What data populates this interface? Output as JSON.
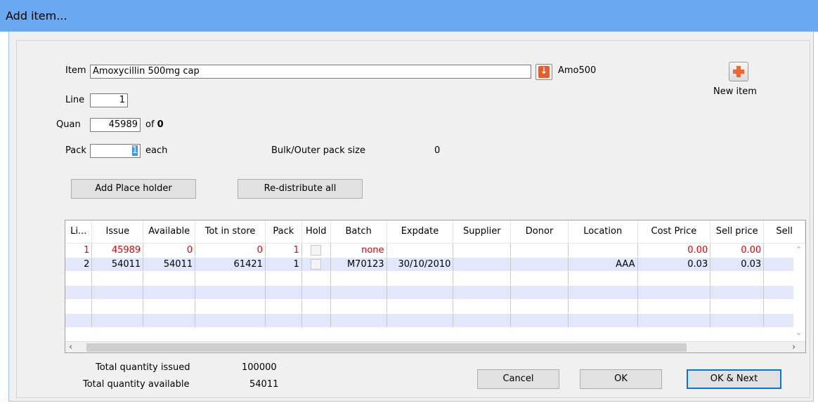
{
  "window": {
    "title": "Add item..."
  },
  "form": {
    "item_label": "Item",
    "item_value": "Amoxycillin 500mg cap",
    "item_code": "Amo500",
    "line_label": "Line",
    "line_value": "1",
    "quan_label": "Quan",
    "quan_value": "45989",
    "quan_of": "of",
    "quan_available": "0",
    "pack_label": "Pack",
    "pack_value": "1",
    "pack_unit": "each",
    "bulk_label": "Bulk/Outer pack size",
    "bulk_value": "0",
    "new_item_label": "New item",
    "add_placeholder_label": "Add Place holder",
    "redistribute_label": "Re-distribute all"
  },
  "grid": {
    "columns": [
      "Li...",
      "Issue",
      "Available",
      "Tot in store",
      "Pack",
      "Hold",
      "Batch",
      "Expdate",
      "Supplier",
      "Donor",
      "Location",
      "Cost Price",
      "Sell price",
      "Sell"
    ],
    "rows": [
      {
        "line": "1",
        "issue": "45989",
        "available": "0",
        "tot_in_store": "0",
        "pack": "1",
        "hold": false,
        "batch": "none",
        "expdate": "",
        "supplier": "",
        "donor": "",
        "location": "",
        "cost_price": "0.00",
        "sell_price": "0.00",
        "sell": ""
      },
      {
        "line": "2",
        "issue": "54011",
        "available": "54011",
        "tot_in_store": "61421",
        "pack": "1",
        "hold": false,
        "batch": "M70123",
        "expdate": "30/10/2010",
        "supplier": "",
        "donor": "",
        "location": "AAA",
        "cost_price": "0.03",
        "sell_price": "0.03",
        "sell": ""
      }
    ]
  },
  "totals": {
    "issued_label": "Total quantity issued",
    "issued_value": "100000",
    "available_label": "Total quantity available",
    "available_value": "54011"
  },
  "buttons": {
    "cancel": "Cancel",
    "ok": "OK",
    "ok_next": "OK & Next"
  },
  "icons": {
    "dropdown": "arrow-down-icon",
    "new_item": "plus-icon"
  }
}
